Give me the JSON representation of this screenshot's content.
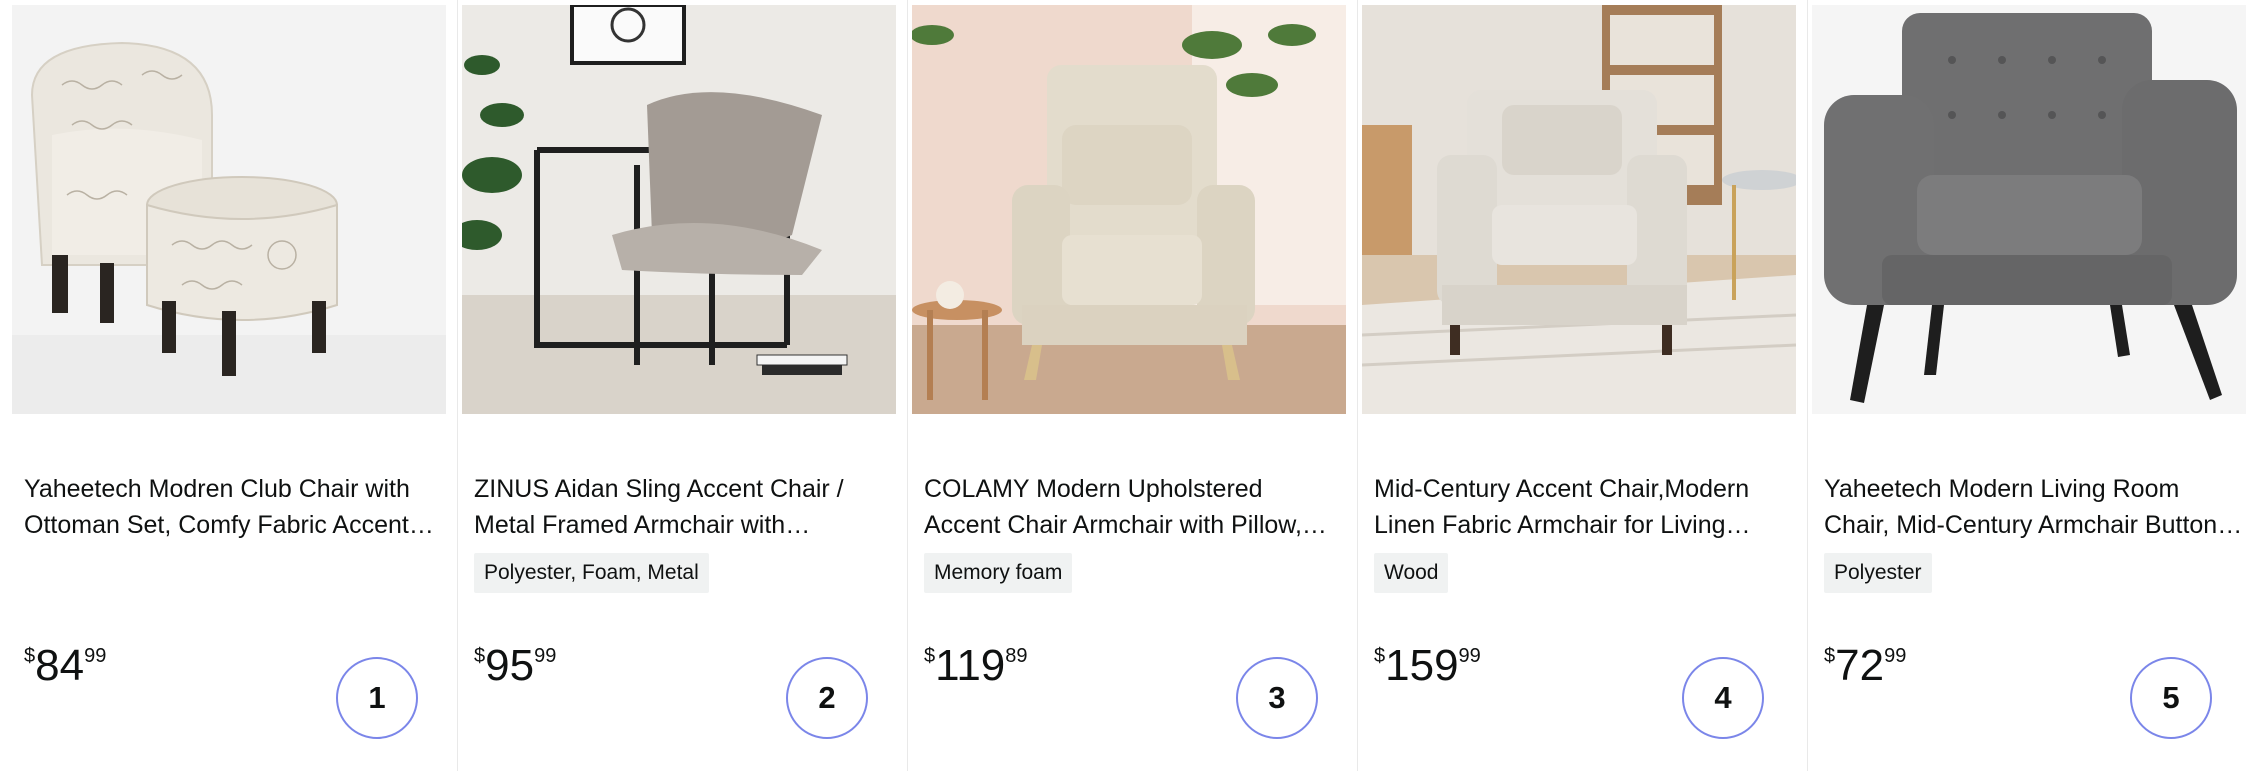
{
  "products": [
    {
      "title": "Yaheetech Modren Club Chair with Ottoman Set, Comfy Fabric Accent Chair",
      "material": "",
      "price_symbol": "$",
      "price_whole": "84",
      "price_fraction": "99",
      "rank": "1",
      "image": "chair-ottoman-script-print"
    },
    {
      "title": "ZINUS Aidan Sling Accent Chair / Metal Framed Armchair with Cushions",
      "material": "Polyester, Foam, Metal",
      "price_symbol": "$",
      "price_whole": "95",
      "price_fraction": "99",
      "rank": "2",
      "image": "sling-chair-metal-frame"
    },
    {
      "title": "COLAMY Modern Upholstered Accent Chair Armchair with Pillow, Fabric Reading Chair",
      "material": "Memory foam",
      "price_symbol": "$",
      "price_whole": "119",
      "price_fraction": "89",
      "rank": "3",
      "image": "upholstered-beige-armchair"
    },
    {
      "title": "Mid-Century Accent Chair,Modern Linen Fabric Armchair for Living Room",
      "material": "Wood",
      "price_symbol": "$",
      "price_whole": "159",
      "price_fraction": "99",
      "rank": "4",
      "image": "linen-armchair-living-room"
    },
    {
      "title": "Yaheetech Modern Living Room Chair, Mid-Century Armchair Button Tufted",
      "material": "Polyester",
      "price_symbol": "$",
      "price_whole": "72",
      "price_fraction": "99",
      "rank": "5",
      "image": "gray-tufted-armchair"
    }
  ],
  "colors": {
    "rank_ring": "#7b86e9",
    "badge_bg": "#f0f2f2",
    "text": "#0f1111"
  }
}
